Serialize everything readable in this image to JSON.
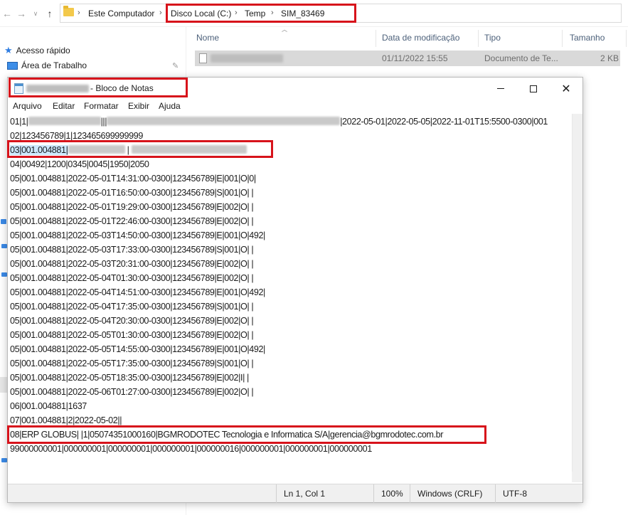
{
  "explorer": {
    "breadcrumb": [
      "Este Computador",
      "Disco Local (C:)",
      "Temp",
      "SIM_83469"
    ],
    "sidebar": [
      {
        "label": "Acesso rápido",
        "icon": "star-icon"
      },
      {
        "label": "Área de Trabalho",
        "icon": "desktop-icon"
      }
    ],
    "columns": [
      "Nome",
      "Data de modificação",
      "Tipo",
      "Tamanho"
    ],
    "files": [
      {
        "name": "",
        "modified": "01/11/2022 15:55",
        "type": "Documento de Te...",
        "size": "2 KB"
      }
    ]
  },
  "notepad": {
    "title_suffix": "- Bloco de Notas",
    "menu": [
      "Arquivo",
      "Editar",
      "Formatar",
      "Exibir",
      "Ajuda"
    ],
    "lines": [
      "01|1|",
      "|2022-05-01|2022-05-05|2022-11-01T15:5500-0300|001",
      "02|123456789|1|123465699999999",
      "03|001.004881|",
      "04|00492|1200|0345|0045|1950|2050",
      "05|001.004881|2022-05-01T14:31:00-0300|123456789|E|001|O|0|",
      "05|001.004881|2022-05-01T16:50:00-0300|123456789|S|001|O| |",
      "05|001.004881|2022-05-01T19:29:00-0300|123456789|E|002|O| |",
      "05|001.004881|2022-05-01T22:46:00-0300|123456789|E|002|O| |",
      "05|001.004881|2022-05-03T14:50:00-0300|123456789|E|001|O|492|",
      "05|001.004881|2022-05-03T17:33:00-0300|123456789|S|001|O| |",
      "05|001.004881|2022-05-03T20:31:00-0300|123456789|E|002|O| |",
      "05|001.004881|2022-05-04T01:30:00-0300|123456789|E|002|O| |",
      "05|001.004881|2022-05-04T14:51:00-0300|123456789|E|001|O|492|",
      "05|001.004881|2022-05-04T17:35:00-0300|123456789|S|001|O| |",
      "05|001.004881|2022-05-04T20:30:00-0300|123456789|E|002|O| |",
      "05|001.004881|2022-05-05T01:30:00-0300|123456789|E|002|O| |",
      "05|001.004881|2022-05-05T14:55:00-0300|123456789|E|001|O|492|",
      "05|001.004881|2022-05-05T17:35:00-0300|123456789|S|001|O| |",
      "05|001.004881|2022-05-05T18:35:00-0300|123456789|E|002|I| |",
      "05|001.004881|2022-05-06T01:27:00-0300|123456789|E|002|O| |",
      "06|001.004881|1637",
      "07|001.004881|2|2022-05-02||",
      "08|ERP GLOBUS| |1|05074351000160|BGMRODOTEC Tecnologia e Informatica S/A|gerencia@bgmrodotec.com.br",
      "99000000001|000000001|000000001|000000001|000000016|000000001|000000001|000000001"
    ],
    "status": {
      "position": "Ln 1, Col 1",
      "zoom": "100%",
      "line_ending": "Windows (CRLF)",
      "encoding": "UTF-8"
    }
  },
  "colors": {
    "highlight": "#d7131b",
    "selection": "#cce8ff"
  }
}
